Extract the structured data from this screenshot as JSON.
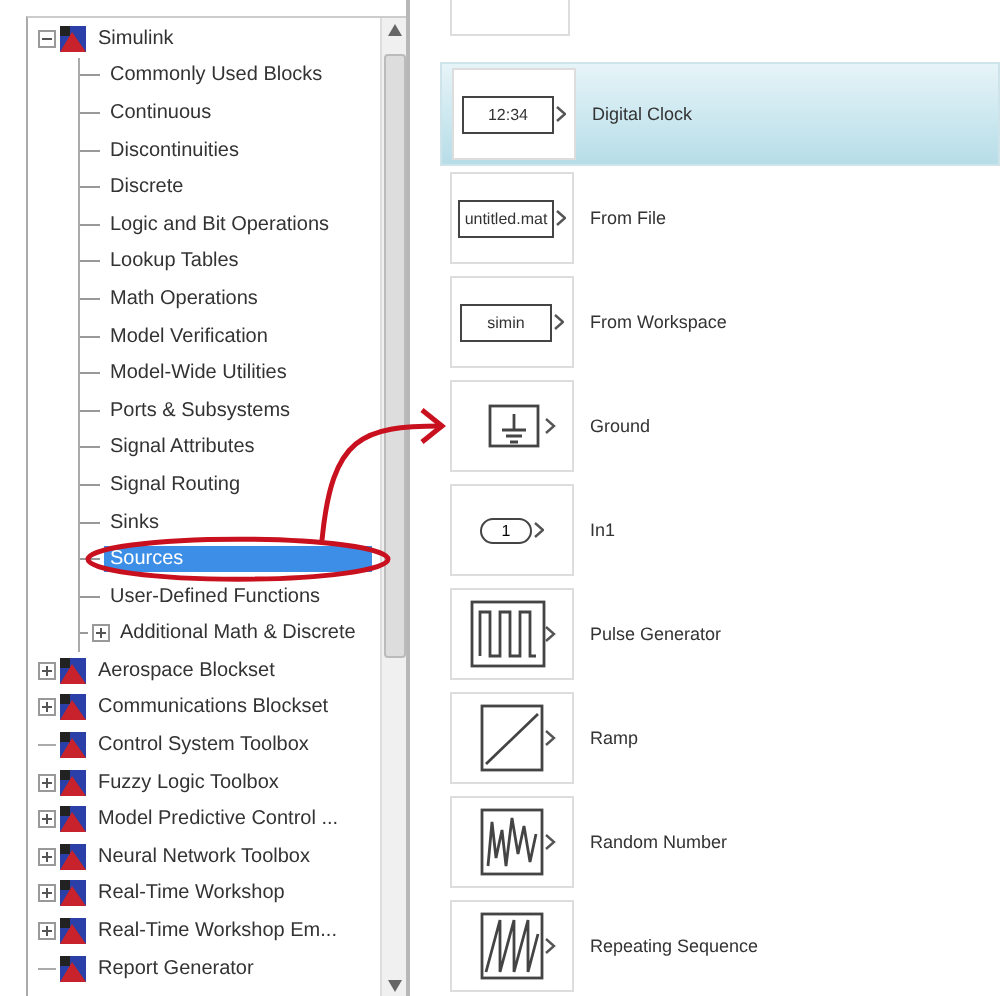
{
  "tree": [
    {
      "label": "Simulink",
      "expanded": true,
      "children": [
        {
          "label": "Commonly Used Blocks",
          "selected": false
        },
        {
          "label": "Continuous",
          "selected": false
        },
        {
          "label": "Discontinuities",
          "selected": false
        },
        {
          "label": "Discrete",
          "selected": false
        },
        {
          "label": "Logic and Bit Operations",
          "selected": false
        },
        {
          "label": "Lookup Tables",
          "selected": false
        },
        {
          "label": "Math Operations",
          "selected": false
        },
        {
          "label": "Model Verification",
          "selected": false
        },
        {
          "label": "Model-Wide Utilities",
          "selected": false
        },
        {
          "label": "Ports & Subsystems",
          "selected": false
        },
        {
          "label": "Signal Attributes",
          "selected": false
        },
        {
          "label": "Signal Routing",
          "selected": false
        },
        {
          "label": "Sinks",
          "selected": false
        },
        {
          "label": "Sources",
          "selected": true
        },
        {
          "label": "User-Defined Functions",
          "selected": false
        },
        {
          "label": "Additional Math & Discrete",
          "selected": false,
          "expanded": false
        }
      ]
    },
    {
      "label": "Aerospace Blockset",
      "expanded": false
    },
    {
      "label": "Communications Blockset",
      "expanded": false
    },
    {
      "label": "Control System Toolbox"
    },
    {
      "label": "Fuzzy Logic Toolbox",
      "expanded": false
    },
    {
      "label": "Model Predictive Control ...",
      "expanded": false
    },
    {
      "label": "Neural Network Toolbox",
      "expanded": false
    },
    {
      "label": "Real-Time Workshop",
      "expanded": false
    },
    {
      "label": "Real-Time Workshop Em...",
      "expanded": false
    },
    {
      "label": "Report Generator"
    }
  ],
  "blocks": [
    {
      "name": "Digital Clock",
      "kind": "display",
      "symbol": "12:34",
      "selected": true
    },
    {
      "name": "From File",
      "kind": "display",
      "symbol": "untitled.mat",
      "selected": false
    },
    {
      "name": "From Workspace",
      "kind": "display",
      "symbol": "simin",
      "selected": false
    },
    {
      "name": "Ground",
      "kind": "ground",
      "selected": false
    },
    {
      "name": "In1",
      "kind": "inport",
      "symbol": "1",
      "selected": false
    },
    {
      "name": "Pulse Generator",
      "kind": "pulse",
      "selected": false
    },
    {
      "name": "Ramp",
      "kind": "ramp",
      "selected": false
    },
    {
      "name": "Random Number",
      "kind": "random",
      "selected": false
    },
    {
      "name": "Repeating Sequence",
      "kind": "repeating",
      "selected": false
    }
  ]
}
